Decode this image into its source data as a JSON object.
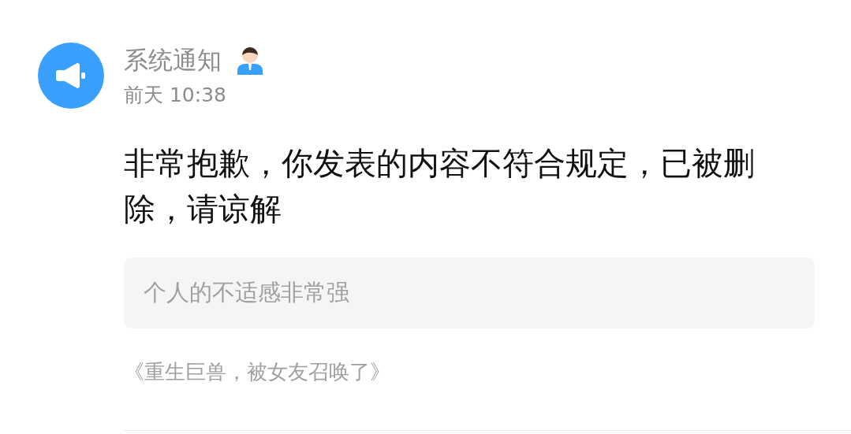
{
  "notification": {
    "sender": "系统通知",
    "time": "前天 10:38",
    "message": "非常抱歉，你发表的内容不符合规定，已被删除，请谅解",
    "quote": "个人的不适感非常强",
    "source": "《重生巨兽，被女友召唤了》"
  }
}
